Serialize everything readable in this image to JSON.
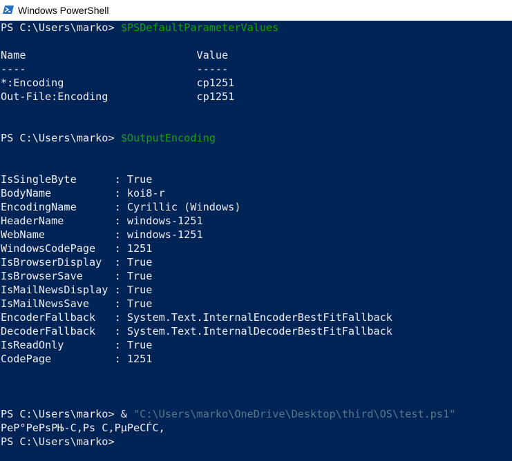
{
  "window": {
    "title": "Windows PowerShell",
    "icon": "powershell-icon"
  },
  "colors": {
    "console_bg": "#012456",
    "text": "#eeedf0",
    "command": "#13a10e",
    "string": "#4f7c8c"
  },
  "console": {
    "line01": {
      "prompt": "PS C:\\Users\\marko> ",
      "command": "$PSDefaultParameterValues"
    },
    "line03": "Name                           Value",
    "line04": "----                           -----",
    "line05": "*:Encoding                     cp1251",
    "line06": "Out-File:Encoding              cp1251",
    "line09": {
      "prompt": "PS C:\\Users\\marko> ",
      "command": "$OutputEncoding"
    },
    "props": [
      "IsSingleByte      : True",
      "BodyName          : koi8-r",
      "EncodingName      : Cyrillic (Windows)",
      "HeaderName        : windows-1251",
      "WebName           : windows-1251",
      "WindowsCodePage   : 1251",
      "IsBrowserDisplay  : True",
      "IsBrowserSave     : True",
      "IsMailNewsDisplay : True",
      "IsMailNewsSave    : True",
      "EncoderFallback   : System.Text.InternalEncoderBestFitFallback",
      "DecoderFallback   : System.Text.InternalDecoderBestFitFallback",
      "IsReadOnly        : True",
      "CodePage          : 1251"
    ],
    "line29": {
      "prompt": "PS C:\\Users\\marko> ",
      "operator": "& ",
      "path": "\"C:\\Users\\marko\\OneDrive\\Desktop\\third\\OS\\test.ps1\""
    },
    "line30": "PeP°PePsPЊ-C,Ps C,PµPeCЃC,",
    "line31": "PS C:\\Users\\marko>"
  }
}
